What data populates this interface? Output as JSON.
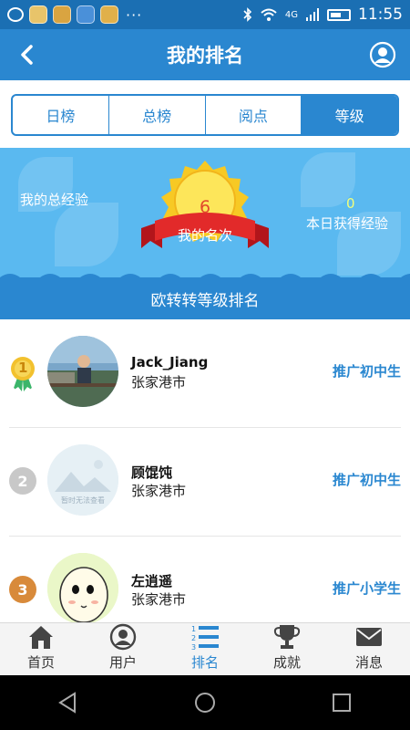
{
  "statusbar": {
    "network": "4G",
    "time": "11:55",
    "notification_dots": "···"
  },
  "header": {
    "title": "我的排名"
  },
  "tabs": [
    {
      "label": "日榜",
      "active": false
    },
    {
      "label": "总榜",
      "active": false
    },
    {
      "label": "阅点",
      "active": false
    },
    {
      "label": "等级",
      "active": true
    }
  ],
  "banner": {
    "total_exp_label": "我的总经验",
    "my_rank_value": "6",
    "my_rank_label": "我的名次",
    "today_exp_value": "0",
    "today_exp_label": "本日获得经验"
  },
  "section": {
    "title": "欧转转等级排名"
  },
  "ranking": [
    {
      "rank": "1",
      "name": "Jack_Jiang",
      "city": "张家港市",
      "level": "推广初中生",
      "avatar": "photo-avatar"
    },
    {
      "rank": "2",
      "name": "顾馄饨",
      "city": "张家港市",
      "level": "推广初中生",
      "avatar": "placeholder-avatar",
      "avatar_text": "暂时无法查看"
    },
    {
      "rank": "3",
      "name": "左逍遥",
      "city": "张家港市",
      "level": "推广小学生",
      "avatar": "cartoon-avatar"
    }
  ],
  "bottom_nav": [
    {
      "label": "首页",
      "icon": "home-icon",
      "active": false
    },
    {
      "label": "用户",
      "icon": "user-icon",
      "active": false
    },
    {
      "label": "排名",
      "icon": "ranking-icon",
      "active": true
    },
    {
      "label": "成就",
      "icon": "trophy-icon",
      "active": false
    },
    {
      "label": "消息",
      "icon": "mail-icon",
      "active": false
    }
  ],
  "colors": {
    "primary": "#2a87d0",
    "banner": "#5ab9f0",
    "rank1": "#f2c12e",
    "rank2": "#c8c8c8",
    "rank3": "#d88a3a"
  }
}
